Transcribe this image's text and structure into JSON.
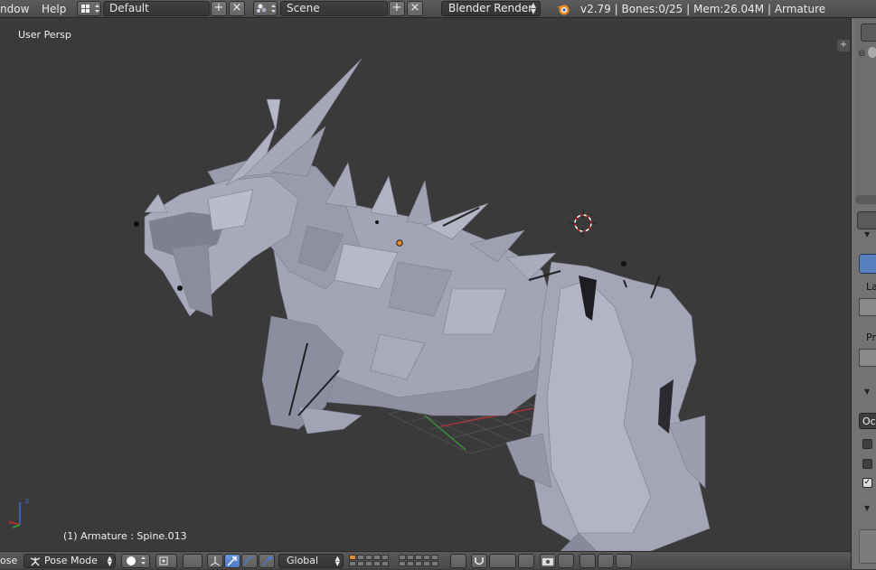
{
  "header": {
    "menu": [
      "ndow",
      "Help"
    ],
    "screen_layout": "Default",
    "scene": "Scene",
    "render_engine": "Blender Render",
    "stats": "v2.79 | Bones:0/25  | Mem:26.04M | Armature"
  },
  "viewport": {
    "view_label": "User Persp",
    "object_info": "(1) Armature : Spine.013"
  },
  "footer": {
    "mode_cut": "ose",
    "mode": "Pose Mode",
    "orientation": "Global"
  },
  "properties": {
    "labels": [
      "La",
      "Pr",
      "Oct"
    ]
  },
  "colors": {
    "viewport_bg": "#3a3a3a",
    "mesh": "#9ea0b2",
    "header_bg": "#4f4f4f",
    "accent_blue": "#5680c2",
    "panel_bg": "#727272"
  },
  "icons": [
    "editor-type-icon",
    "add-icon",
    "close-icon",
    "blender-logo-icon",
    "cursor-3d-icon",
    "axis-gizmo-icon",
    "pose-mode-icon",
    "shading-icon",
    "pivot-icon",
    "manipulator-icon",
    "magnet-icon",
    "camera-icon"
  ]
}
